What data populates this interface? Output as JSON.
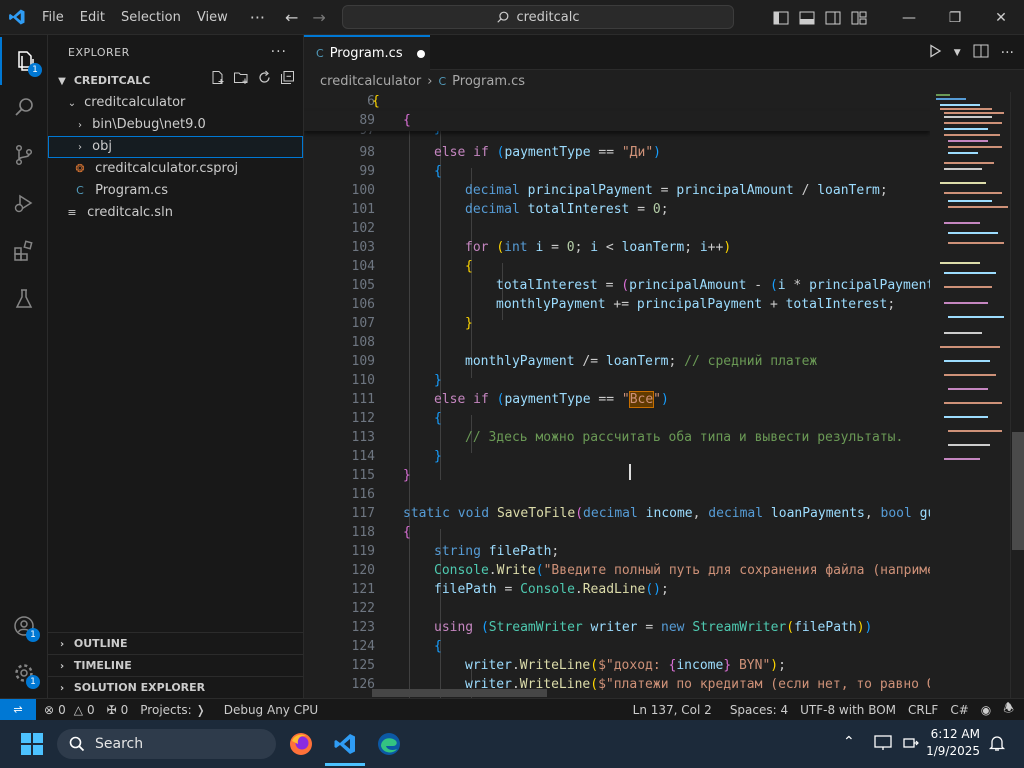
{
  "titlebar": {
    "menus": [
      "File",
      "Edit",
      "Selection",
      "View"
    ],
    "more": "···",
    "search": "creditcalc"
  },
  "activity": {
    "explorer_badge": "1",
    "accounts_badge": "1",
    "settings_badge": "1"
  },
  "sidebar": {
    "title": "EXPLORER",
    "dots": "···",
    "root": "CREDITCALC",
    "folder": "creditcalculator",
    "items": [
      {
        "label": "bin\\Debug\\net9.0"
      },
      {
        "label": "obj"
      },
      {
        "label": "creditcalculator.csproj"
      },
      {
        "label": "Program.cs"
      },
      {
        "label": "creditcalc.sln"
      }
    ],
    "sections": [
      "OUTLINE",
      "TIMELINE",
      "SOLUTION EXPLORER"
    ]
  },
  "editor": {
    "tab": "Program.cs",
    "breadcrumb": [
      "creditcalculator",
      "Program.cs"
    ]
  },
  "status": {
    "errors": "0",
    "warnings": "0",
    "ports": "0",
    "projects": "Projects:",
    "config": "Debug Any CPU",
    "position": "Ln 137, Col 2",
    "spaces": "Spaces: 4",
    "encoding": "UTF-8 with BOM",
    "eol": "CRLF",
    "lang": "C#"
  },
  "taskbar": {
    "search": "Search",
    "time": "6:12 AM",
    "date": "1/9/2025"
  },
  "colors": {
    "accent": "#0078d4",
    "bg": "#1f1f1f",
    "sidebar": "#181818",
    "taskbar": "#1c2a3a"
  }
}
